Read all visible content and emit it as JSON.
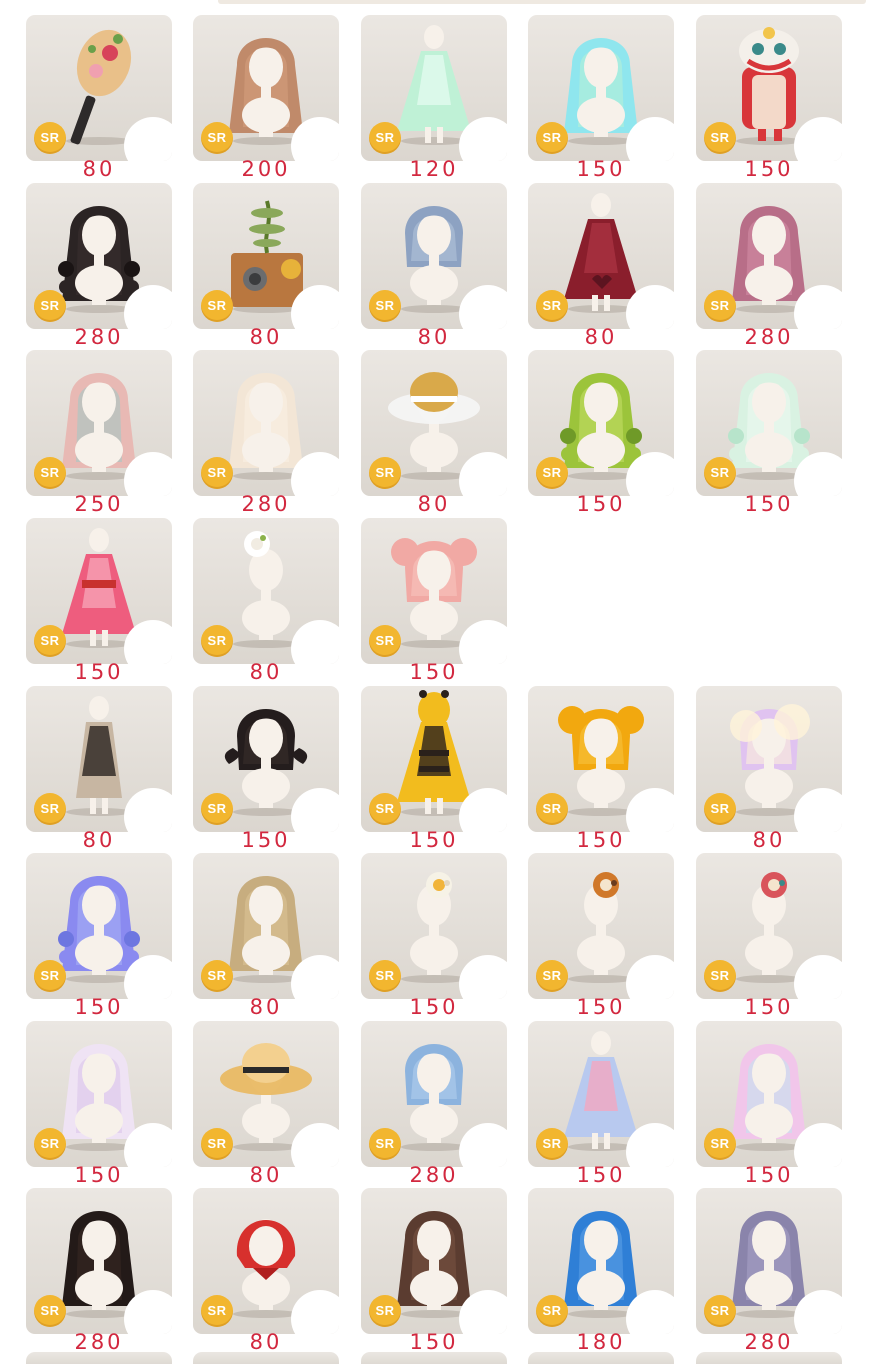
{
  "badge_label": "SR",
  "colors": {
    "price": "#d2283f",
    "badge": "#f2b62f",
    "card_top": "#ebe7e2",
    "card_bottom": "#dbd6cf"
  },
  "rows": [
    [
      {
        "item": "paddle-fan",
        "price": "80"
      },
      {
        "item": "long-wavy-hair-auburn",
        "price": "200"
      },
      {
        "item": "ghost-gown-mint",
        "price": "120"
      },
      {
        "item": "long-hair-aqua-gradient",
        "price": "150"
      },
      {
        "item": "lion-dance-costume",
        "price": "150"
      }
    ],
    [
      {
        "item": "black-braided-hair",
        "price": "280"
      },
      {
        "item": "bonsai-clockwork-box",
        "price": "80"
      },
      {
        "item": "silver-blue-short-hair",
        "price": "80"
      },
      {
        "item": "burgundy-heart-dress",
        "price": "80"
      },
      {
        "item": "rose-twin-loop-hair",
        "price": "280"
      }
    ],
    [
      {
        "item": "pastel-striped-hair",
        "price": "250"
      },
      {
        "item": "cream-wavy-hair",
        "price": "280"
      },
      {
        "item": "glass-brim-hat",
        "price": "80"
      },
      {
        "item": "green-braided-hair",
        "price": "150"
      },
      {
        "item": "mint-pale-braids",
        "price": "150"
      }
    ],
    [
      {
        "item": "pink-kimono",
        "price": "150"
      },
      {
        "item": "white-flower-hairpin",
        "price": "80"
      },
      {
        "item": "pink-bun-hair",
        "price": "150"
      }
    ],
    [
      {
        "item": "long-coat-outfit",
        "price": "80"
      },
      {
        "item": "black-horn-hair",
        "price": "150"
      },
      {
        "item": "bee-costume",
        "price": "150"
      },
      {
        "item": "yellow-bun-bob-hair",
        "price": "150"
      },
      {
        "item": "dreamy-cloud-hair",
        "price": "80"
      }
    ],
    [
      {
        "item": "purple-bubble-braids",
        "price": "150"
      },
      {
        "item": "blonde-straight-hair",
        "price": "80"
      },
      {
        "item": "chick-head-accessory",
        "price": "150"
      },
      {
        "item": "squirrel-head-accessory",
        "price": "150"
      },
      {
        "item": "lion-mask-head-accessory",
        "price": "150"
      }
    ],
    [
      {
        "item": "lilac-twin-curls",
        "price": "150"
      },
      {
        "item": "straw-sun-hat",
        "price": "80"
      },
      {
        "item": "blue-wave-hair",
        "price": "280"
      },
      {
        "item": "starry-pastel-dress",
        "price": "150"
      },
      {
        "item": "rainbow-long-hair",
        "price": "150"
      }
    ],
    [
      {
        "item": "black-curly-long-hair",
        "price": "280"
      },
      {
        "item": "red-riding-hood",
        "price": "80"
      },
      {
        "item": "brown-twin-tails",
        "price": "150"
      },
      {
        "item": "blue-straight-hair",
        "price": "180"
      },
      {
        "item": "lavender-wavy-hair",
        "price": "280"
      }
    ]
  ]
}
